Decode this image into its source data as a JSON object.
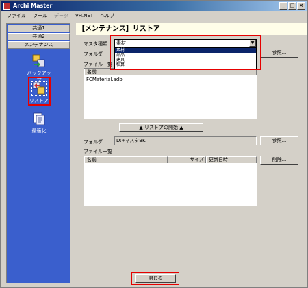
{
  "window": {
    "title": "Archi Master",
    "minimize": "_",
    "maximize": "□",
    "close": "×"
  },
  "menu": [
    "ファイル",
    "ツール",
    "データ",
    "VH.NET",
    "ヘルプ"
  ],
  "nav": {
    "tabs": [
      "共通1",
      "共通2",
      "メンテナンス"
    ],
    "items": [
      {
        "label": "バックアップ",
        "icon": "backup-icon"
      },
      {
        "label": "リストア",
        "icon": "restore-icon"
      },
      {
        "label": "最適化",
        "icon": "optimize-icon"
      }
    ]
  },
  "header": {
    "title": "【メンテナンス】リストア"
  },
  "master_type": {
    "label": "マスタ種類",
    "value": "素材",
    "options": [
      "素材",
      "部品",
      "建具",
      "積算"
    ]
  },
  "restore_source": {
    "folder_label": "フォルダ",
    "folder_value": "",
    "browse_label": "参照...",
    "filelist_label": "ファイル一覧",
    "column_name": "名前",
    "files": [
      "FCMaterial.adb"
    ]
  },
  "start_button": "▲ リストアの開始 ▲",
  "restore_dest": {
    "folder_label": "フォルダ",
    "folder_value": "D:¥マスタBK",
    "browse_label": "参照...",
    "filelist_label": "ファイル一覧",
    "columns": [
      "名前",
      "サイズ",
      "更新日時"
    ],
    "delete_label": "削除..."
  },
  "close_button": "閉じる",
  "colors": {
    "nav_bg": "#3a5fcd",
    "header_bg": "#fffde8",
    "highlight": "#e60000"
  }
}
